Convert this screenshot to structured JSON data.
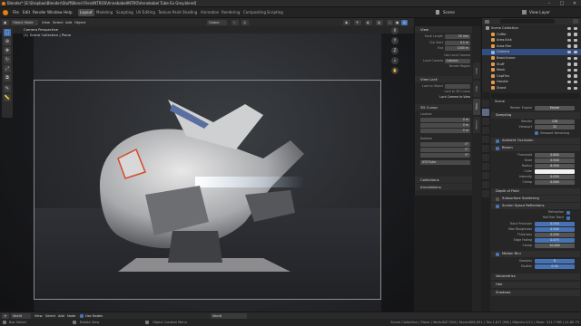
{
  "title": "Blender* [E:\\Dropbox\\Blender\\Stuff\\Blend Files\\INTROS\\AnnebabelINTRO\\Annebabel Tube Ex Grey.blend]",
  "menus": [
    "File",
    "Edit",
    "Render",
    "Window",
    "Help"
  ],
  "workspaces": [
    "Layout",
    "Modeling",
    "Sculpting",
    "UV Editing",
    "Texture Paint",
    "Shading",
    "Animation",
    "Rendering",
    "Compositing",
    "Scripting"
  ],
  "active_workspace": "Layout",
  "scene_label": "Scene",
  "view_layer_label": "View Layer",
  "viewport": {
    "mode": "Object Mode",
    "header_menus": [
      "View",
      "Select",
      "Add",
      "Object"
    ],
    "overlay_text_1": "Camera Perspective",
    "overlay_text_2": "(1) Scene Collection | Plane",
    "orientation": "Global",
    "gizmo": [
      "X",
      "Y",
      "Z"
    ]
  },
  "sidebar": {
    "view_title": "View",
    "focal_length_label": "Focal Length",
    "focal_length": "50 mm",
    "clip_start_label": "Clip Start",
    "clip_start": "0.1 m",
    "clip_end_label": "End",
    "clip_end": "1000 m",
    "use_local_camera": "Use Local Camera",
    "local_camera_label": "Local Camera",
    "local_camera": "Camera",
    "render_region": "Render Region",
    "view_lock_title": "View Lock",
    "lock_to_object_label": "Lock to Object",
    "lock_to_3d_cursor": "Lock to 3D Cursor",
    "lock_camera_to_view": "Lock Camera to View",
    "cursor_title": "3D Cursor",
    "location_label": "Location",
    "loc_x": "0 m",
    "loc_y": "0 m",
    "loc_z": "0 m",
    "rotation_label": "Rotation",
    "rot_x": "0°",
    "rot_y": "0°",
    "rot_z": "0°",
    "rotation_mode": "XYZ Euler",
    "collections_title": "Collections",
    "annotations_title": "Annotations",
    "tabs": [
      "Item",
      "Tool",
      "View",
      "Create"
    ]
  },
  "outliner": {
    "rows": [
      {
        "name": "Scene Collection",
        "indent": 0,
        "color": "#9a9a9a",
        "sel": false
      },
      {
        "name": "Coffer",
        "indent": 1,
        "color": "#e09a4c",
        "sel": false
      },
      {
        "name": "Area.Kick",
        "indent": 1,
        "color": "#e09a4c",
        "sel": false
      },
      {
        "name": "Area.Rim",
        "indent": 1,
        "color": "#e09a4c",
        "sel": false
      },
      {
        "name": "Camera",
        "indent": 1,
        "color": "#8fb3e0",
        "sel": true
      },
      {
        "name": "BasicScene",
        "indent": 1,
        "color": "#e09a4c",
        "sel": false
      },
      {
        "name": "Stuff",
        "indent": 1,
        "color": "#e09a4c",
        "sel": false
      },
      {
        "name": "Mesh",
        "indent": 1,
        "color": "#e09a4c",
        "sel": false
      },
      {
        "name": "CapFins",
        "indent": 1,
        "color": "#e09a4c",
        "sel": false
      },
      {
        "name": "Handle",
        "indent": 1,
        "color": "#e09a4c",
        "sel": false
      },
      {
        "name": "Stand",
        "indent": 1,
        "color": "#e09a4c",
        "sel": false
      }
    ]
  },
  "properties": {
    "scene_label": "Scene",
    "render_engine_label": "Render Engine",
    "render_engine": "Eevee",
    "sampling": "Sampling",
    "render_label": "Render",
    "render_samples": "128",
    "viewport_label": "Viewport",
    "viewport_samples": "32",
    "viewport_denoising": "Viewport Denoising",
    "ambient_occlusion": "Ambient Occlusion",
    "bloom": "Bloom",
    "threshold_label": "Threshold",
    "threshold": "0.800",
    "knee_label": "Knee",
    "knee": "0.500",
    "radius_label": "Radius",
    "radius": "6.500",
    "color_label": "Color",
    "intensity_label": "Intensity",
    "intensity": "0.050",
    "clamp_label": "Clamp",
    "clamp": "0.000",
    "depth_of_field": "Depth of Field",
    "subsurface": "Subsurface Scattering",
    "ssr": "Screen Space Reflections",
    "refraction": "Refraction",
    "half_res_trace": "Half Res Trace",
    "trace_precision_label": "Trace Precision",
    "trace_precision": "0.250",
    "max_roughness_label": "Max Roughness",
    "max_roughness": "0.500",
    "thickness_label": "Thickness",
    "thickness": "0.200",
    "edge_fading_label": "Edge Fading",
    "edge_fading": "0.075",
    "clamp2_label": "Clamp",
    "clamp2": "10.000",
    "motion_blur": "Motion Blur",
    "mb_samples_label": "Samples",
    "mb_samples": "8",
    "mb_shutter_label": "Shutter",
    "mb_shutter": "0.50",
    "volumetrics": "Volumetrics",
    "hair": "Hair",
    "shadows": "Shadows"
  },
  "timeline": {
    "mode": "World",
    "menus": [
      "View",
      "Select",
      "Add",
      "Node"
    ],
    "use_nodes": "Use Nodes",
    "world_name": "World"
  },
  "status": {
    "left": "Box Select",
    "mid1": "Rotate View",
    "mid2": "Object Context Menu",
    "right": "Scene Collection | Plane | Verts:847,904 | Faces:808,091 | Tris:1,617,396 | Objects:1/11 | Mem: 311.7 MB | v2.80.75"
  }
}
